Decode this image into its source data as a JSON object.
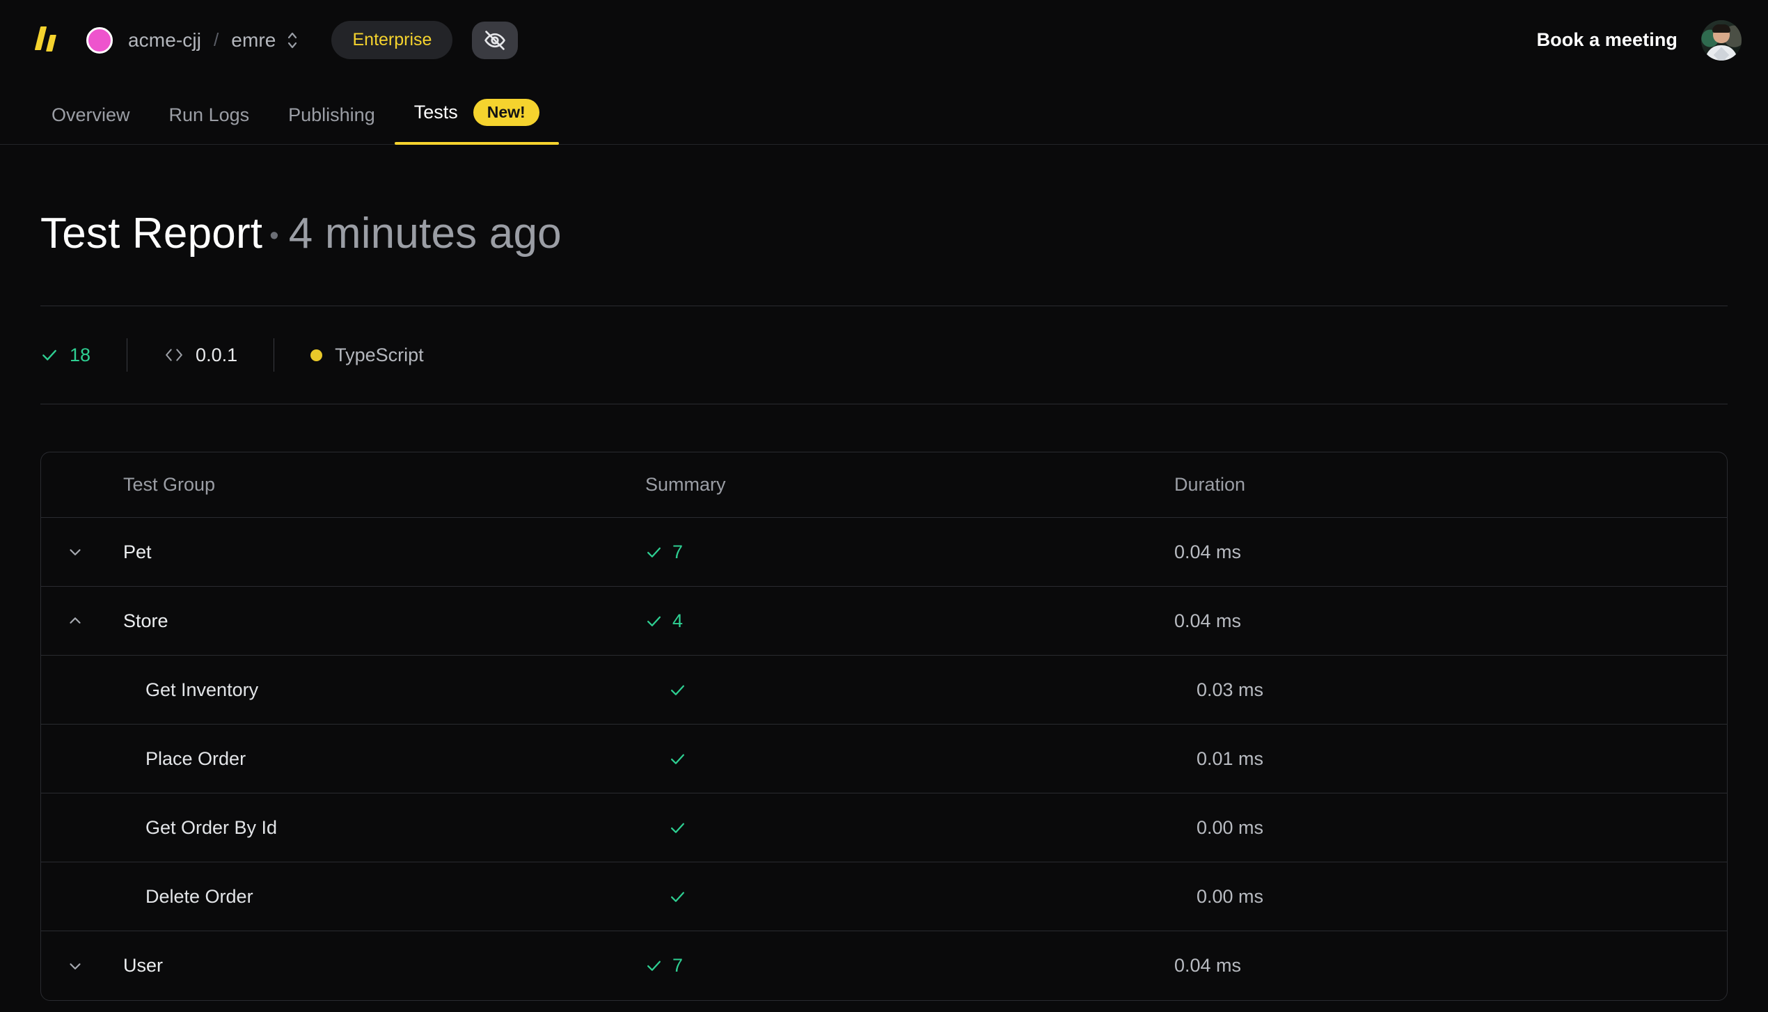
{
  "topbar": {
    "logo_icon": "speakeasy-logo-icon",
    "org_avatar_icon": "org-avatar",
    "org_name": "acme-cjj",
    "separator": "/",
    "workspace_name": "emre",
    "workspace_switcher_icon": "chevron-up-down-icon",
    "plan_badge": "Enterprise",
    "visibility_icon": "eye-off-icon",
    "book_meeting_label": "Book a meeting",
    "user_avatar_icon": "user-avatar"
  },
  "nav": {
    "tabs": [
      {
        "label": "Overview",
        "active": false
      },
      {
        "label": "Run Logs",
        "active": false
      },
      {
        "label": "Publishing",
        "active": false
      },
      {
        "label": "Tests",
        "active": true,
        "badge": "New!"
      }
    ]
  },
  "page": {
    "title": "Test Report",
    "separator_dot": "•",
    "timestamp": "4 minutes ago"
  },
  "meta": {
    "passed_icon": "check-icon",
    "passed_count": "18",
    "version_icon": "code-brackets-icon",
    "version": "0.0.1",
    "language_dot_color": "#e9c92a",
    "language": "TypeScript"
  },
  "table": {
    "columns": {
      "group": "Test Group",
      "summary": "Summary",
      "duration": "Duration"
    },
    "rows": [
      {
        "type": "group",
        "chevron": "chevron-down-icon",
        "expanded": false,
        "name": "Pet",
        "summary_icon": "check-icon",
        "summary_count": "7",
        "duration": "0.04 ms"
      },
      {
        "type": "group",
        "chevron": "chevron-up-icon",
        "expanded": true,
        "name": "Store",
        "summary_icon": "check-icon",
        "summary_count": "4",
        "duration": "0.04 ms"
      },
      {
        "type": "child",
        "name": "Get Inventory",
        "summary_icon": "check-icon",
        "summary_count": "",
        "duration": "0.03 ms"
      },
      {
        "type": "child",
        "name": "Place Order",
        "summary_icon": "check-icon",
        "summary_count": "",
        "duration": "0.01 ms"
      },
      {
        "type": "child",
        "name": "Get Order By Id",
        "summary_icon": "check-icon",
        "summary_count": "",
        "duration": "0.00 ms"
      },
      {
        "type": "child",
        "name": "Delete Order",
        "summary_icon": "check-icon",
        "summary_count": "",
        "duration": "0.00 ms"
      },
      {
        "type": "group",
        "chevron": "chevron-down-icon",
        "expanded": false,
        "name": "User",
        "summary_icon": "check-icon",
        "summary_count": "7",
        "duration": "0.04 ms"
      }
    ]
  },
  "colors": {
    "background": "#0a0a0b",
    "accent_yellow": "#f5d32e",
    "pass_green": "#2ecf92",
    "border": "#2a2b30",
    "text_muted": "#9b9ea5",
    "org_avatar_pink": "#ee54cd"
  }
}
